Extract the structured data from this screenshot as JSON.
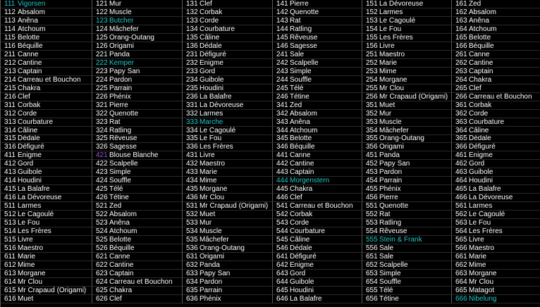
{
  "colors": {
    "background": "#000000",
    "text": "#ffffff",
    "highlight": "#22c7c7",
    "purple": "#9a55d8",
    "gridline": "#5a5a5a"
  },
  "columns": [
    {
      "rows": [
        {
          "n": "111",
          "name": "Vigorsen",
          "hl": "full"
        },
        {
          "n": "112",
          "name": "Absalom"
        },
        {
          "n": "113",
          "name": "Anêna"
        },
        {
          "n": "114",
          "name": "Atchoum"
        },
        {
          "n": "115",
          "name": "Belotte"
        },
        {
          "n": "116",
          "name": "Béquille"
        },
        {
          "n": "211",
          "name": "Canne"
        },
        {
          "n": "212",
          "name": "Cantine"
        },
        {
          "n": "213",
          "name": "Captain"
        },
        {
          "n": "214",
          "name": "Carreau et Bouchon"
        },
        {
          "n": "215",
          "name": "Chakra"
        },
        {
          "n": "216",
          "name": "Clef"
        },
        {
          "n": "311",
          "name": "Corbak"
        },
        {
          "n": "312",
          "name": "Corde"
        },
        {
          "n": "313",
          "name": "Courbature"
        },
        {
          "n": "314",
          "name": "Câline"
        },
        {
          "n": "315",
          "name": "Dédale"
        },
        {
          "n": "316",
          "name": "Défiguré"
        },
        {
          "n": "411",
          "name": "Enigme"
        },
        {
          "n": "412",
          "name": "Gord"
        },
        {
          "n": "413",
          "name": "Guibole"
        },
        {
          "n": "414",
          "name": "Houdini"
        },
        {
          "n": "415",
          "name": "La Balafre"
        },
        {
          "n": "416",
          "name": "La Dévoreuse"
        },
        {
          "n": "511",
          "name": "Larmes"
        },
        {
          "n": "512",
          "name": "Le Cagoulé"
        },
        {
          "n": "513",
          "name": "Le Fou"
        },
        {
          "n": "514",
          "name": "Les Frères"
        },
        {
          "n": "515",
          "name": "Livre"
        },
        {
          "n": "516",
          "name": "Maestro"
        },
        {
          "n": "611",
          "name": "Marie"
        },
        {
          "n": "612",
          "name": "Mime"
        },
        {
          "n": "613",
          "name": "Morgane"
        },
        {
          "n": "614",
          "name": "Mr Clou"
        },
        {
          "n": "615",
          "name": "Mr Crapaud (Origami)"
        },
        {
          "n": "616",
          "name": "Muet"
        }
      ]
    },
    {
      "rows": [
        {
          "n": "121",
          "name": "Mur"
        },
        {
          "n": "122",
          "name": "Muscle"
        },
        {
          "n": "123",
          "name": "Butcher",
          "hl": "full"
        },
        {
          "n": "124",
          "name": "Mâchefer"
        },
        {
          "n": "125",
          "name": "Orang-Outang"
        },
        {
          "n": "126",
          "name": "Origami"
        },
        {
          "n": "221",
          "name": "Panda"
        },
        {
          "n": "222",
          "name": "Kemper",
          "hl": "full"
        },
        {
          "n": "223",
          "name": "Papy San"
        },
        {
          "n": "224",
          "name": "Pardon"
        },
        {
          "n": "225",
          "name": "Parrain"
        },
        {
          "n": "226",
          "name": "Phénix"
        },
        {
          "n": "321",
          "name": "Pierre"
        },
        {
          "n": "322",
          "name": "Quenotte"
        },
        {
          "n": "323",
          "name": "Rat"
        },
        {
          "n": "324",
          "name": "Ratling"
        },
        {
          "n": "325",
          "name": "Rêveuse"
        },
        {
          "n": "326",
          "name": "Sagesse"
        },
        {
          "n": "421",
          "name": "Blouse Blanche",
          "hl": "purplenum"
        },
        {
          "n": "422",
          "name": "Scalpelle"
        },
        {
          "n": "423",
          "name": "Simple"
        },
        {
          "n": "424",
          "name": "Souffle"
        },
        {
          "n": "425",
          "name": "Télé"
        },
        {
          "n": "426",
          "name": "Tétine"
        },
        {
          "n": "521",
          "name": "Zed"
        },
        {
          "n": "522",
          "name": "Absalom"
        },
        {
          "n": "523",
          "name": "Anêna"
        },
        {
          "n": "524",
          "name": "Atchoum"
        },
        {
          "n": "525",
          "name": "Belotte"
        },
        {
          "n": "526",
          "name": "Béquille"
        },
        {
          "n": "621",
          "name": "Canne"
        },
        {
          "n": "622",
          "name": "Cantine"
        },
        {
          "n": "623",
          "name": "Captain"
        },
        {
          "n": "624",
          "name": "Carreau et Bouchon"
        },
        {
          "n": "625",
          "name": "Chakra"
        },
        {
          "n": "626",
          "name": "Clef"
        }
      ]
    },
    {
      "rows": [
        {
          "n": "131",
          "name": "Clef"
        },
        {
          "n": "132",
          "name": "Corbak"
        },
        {
          "n": "133",
          "name": "Corde"
        },
        {
          "n": "134",
          "name": "Courbature"
        },
        {
          "n": "135",
          "name": "Câline"
        },
        {
          "n": "136",
          "name": "Dédale"
        },
        {
          "n": "231",
          "name": "Défiguré"
        },
        {
          "n": "232",
          "name": "Enigme"
        },
        {
          "n": "233",
          "name": "Gord"
        },
        {
          "n": "234",
          "name": "Guibole"
        },
        {
          "n": "235",
          "name": "Houdini"
        },
        {
          "n": "236",
          "name": "La Balafre"
        },
        {
          "n": "331",
          "name": "La Dévoreuse"
        },
        {
          "n": "332",
          "name": "Larmes"
        },
        {
          "n": "333",
          "name": "Marche",
          "hl": "full"
        },
        {
          "n": "334",
          "name": "Le Cagoulé"
        },
        {
          "n": "335",
          "name": "Le Fou"
        },
        {
          "n": "336",
          "name": "Les Frères"
        },
        {
          "n": "431",
          "name": "Livre"
        },
        {
          "n": "432",
          "name": "Maestro"
        },
        {
          "n": "433",
          "name": "Marie"
        },
        {
          "n": "434",
          "name": "Mime"
        },
        {
          "n": "435",
          "name": "Morgane"
        },
        {
          "n": "436",
          "name": "Mr Clou"
        },
        {
          "n": "531",
          "name": "Mr Crapaud (Origami)"
        },
        {
          "n": "532",
          "name": "Muet"
        },
        {
          "n": "533",
          "name": "Mur"
        },
        {
          "n": "534",
          "name": "Muscle"
        },
        {
          "n": "535",
          "name": "Mâchefer"
        },
        {
          "n": "536",
          "name": "Orang-Outang"
        },
        {
          "n": "631",
          "name": "Origami"
        },
        {
          "n": "632",
          "name": "Panda"
        },
        {
          "n": "633",
          "name": "Papy San"
        },
        {
          "n": "634",
          "name": "Pardon"
        },
        {
          "n": "635",
          "name": "Parrain"
        },
        {
          "n": "636",
          "name": "Phénix"
        }
      ]
    },
    {
      "rows": [
        {
          "n": "141",
          "name": "Pierre"
        },
        {
          "n": "142",
          "name": "Quenotte"
        },
        {
          "n": "143",
          "name": "Rat"
        },
        {
          "n": "144",
          "name": "Ratling"
        },
        {
          "n": "145",
          "name": "Rêveuse"
        },
        {
          "n": "146",
          "name": "Sagesse"
        },
        {
          "n": "241",
          "name": "Sale"
        },
        {
          "n": "242",
          "name": "Scalpelle"
        },
        {
          "n": "243",
          "name": "Simple"
        },
        {
          "n": "244",
          "name": "Souffle"
        },
        {
          "n": "245",
          "name": "Télé"
        },
        {
          "n": "246",
          "name": "Tétine"
        },
        {
          "n": "341",
          "name": "Zed"
        },
        {
          "n": "342",
          "name": "Absalom"
        },
        {
          "n": "343",
          "name": "Anêna"
        },
        {
          "n": "344",
          "name": "Atchoum"
        },
        {
          "n": "345",
          "name": "Belotte"
        },
        {
          "n": "346",
          "name": "Béquille"
        },
        {
          "n": "441",
          "name": "Canne"
        },
        {
          "n": "442",
          "name": "Cantine"
        },
        {
          "n": "443",
          "name": "Captain"
        },
        {
          "n": "444",
          "name": "Morgenstern",
          "hl": "full"
        },
        {
          "n": "445",
          "name": "Chakra"
        },
        {
          "n": "446",
          "name": "Clef"
        },
        {
          "n": "541",
          "name": "Carreau et Bouchon"
        },
        {
          "n": "542",
          "name": "Corbak"
        },
        {
          "n": "543",
          "name": "Corde"
        },
        {
          "n": "544",
          "name": "Courbature"
        },
        {
          "n": "545",
          "name": "Câline"
        },
        {
          "n": "546",
          "name": "Dédale"
        },
        {
          "n": "641",
          "name": "Défiguré"
        },
        {
          "n": "642",
          "name": "Enigme"
        },
        {
          "n": "643",
          "name": "Gord"
        },
        {
          "n": "644",
          "name": "Guibole"
        },
        {
          "n": "645",
          "name": "Houdini"
        },
        {
          "n": "646",
          "name": "La Balafre"
        }
      ]
    },
    {
      "rows": [
        {
          "n": "151",
          "name": "La Dévoreuse"
        },
        {
          "n": "152",
          "name": "Larmes"
        },
        {
          "n": "153",
          "name": "Le Cagoulé"
        },
        {
          "n": "154",
          "name": "Le Fou"
        },
        {
          "n": "155",
          "name": "Les Frères"
        },
        {
          "n": "156",
          "name": "Livre"
        },
        {
          "n": "251",
          "name": "Maestro"
        },
        {
          "n": "252",
          "name": "Marie"
        },
        {
          "n": "253",
          "name": "Mime"
        },
        {
          "n": "254",
          "name": "Morgane"
        },
        {
          "n": "255",
          "name": "Mr Clou"
        },
        {
          "n": "256",
          "name": "Mr Crapaud (Origami)"
        },
        {
          "n": "351",
          "name": "Muet"
        },
        {
          "n": "352",
          "name": "Mur"
        },
        {
          "n": "353",
          "name": "Muscle"
        },
        {
          "n": "354",
          "name": "Mâchefer"
        },
        {
          "n": "355",
          "name": "Orang-Outang"
        },
        {
          "n": "356",
          "name": "Origami"
        },
        {
          "n": "451",
          "name": "Panda"
        },
        {
          "n": "452",
          "name": "Papy San"
        },
        {
          "n": "453",
          "name": "Pardon"
        },
        {
          "n": "454",
          "name": "Parrain"
        },
        {
          "n": "455",
          "name": "Phénix"
        },
        {
          "n": "456",
          "name": "Pierre"
        },
        {
          "n": "551",
          "name": "Quenotte"
        },
        {
          "n": "552",
          "name": "Rat"
        },
        {
          "n": "553",
          "name": "Ratling"
        },
        {
          "n": "554",
          "name": "Rêveuse"
        },
        {
          "n": "555",
          "name": "Stein & Frank",
          "hl": "full"
        },
        {
          "n": "556",
          "name": "Sale"
        },
        {
          "n": "651",
          "name": "Sale"
        },
        {
          "n": "652",
          "name": "Scalpelle"
        },
        {
          "n": "653",
          "name": "Simple"
        },
        {
          "n": "654",
          "name": "Souffle"
        },
        {
          "n": "655",
          "name": "Télé"
        },
        {
          "n": "656",
          "name": "Tétine"
        }
      ]
    },
    {
      "rows": [
        {
          "n": "161",
          "name": "Zed"
        },
        {
          "n": "162",
          "name": "Absalom"
        },
        {
          "n": "163",
          "name": "Anêna"
        },
        {
          "n": "164",
          "name": "Atchoum"
        },
        {
          "n": "165",
          "name": "Belotte"
        },
        {
          "n": "166",
          "name": "Béquille"
        },
        {
          "n": "261",
          "name": "Canne"
        },
        {
          "n": "262",
          "name": "Cantine"
        },
        {
          "n": "263",
          "name": "Captain"
        },
        {
          "n": "264",
          "name": "Chakra"
        },
        {
          "n": "265",
          "name": "Clef"
        },
        {
          "n": "266",
          "name": "Carreau et Bouchon"
        },
        {
          "n": "361",
          "name": "Corbak"
        },
        {
          "n": "362",
          "name": "Corde"
        },
        {
          "n": "363",
          "name": "Courbature"
        },
        {
          "n": "364",
          "name": "Câline"
        },
        {
          "n": "365",
          "name": "Dédale"
        },
        {
          "n": "366",
          "name": "Défiguré"
        },
        {
          "n": "461",
          "name": "Enigme"
        },
        {
          "n": "462",
          "name": "Gord"
        },
        {
          "n": "463",
          "name": "Guibole"
        },
        {
          "n": "464",
          "name": "Houdini"
        },
        {
          "n": "465",
          "name": "La Balafre"
        },
        {
          "n": "466",
          "name": "La Dévoreuse"
        },
        {
          "n": "561",
          "name": "Larmes"
        },
        {
          "n": "562",
          "name": "Le Cagoulé"
        },
        {
          "n": "563",
          "name": "Le Fou"
        },
        {
          "n": "564",
          "name": "Les Frères"
        },
        {
          "n": "565",
          "name": "Livre"
        },
        {
          "n": "566",
          "name": "Maestro"
        },
        {
          "n": "661",
          "name": "Marie"
        },
        {
          "n": "662",
          "name": "Mime"
        },
        {
          "n": "663",
          "name": "Morgane"
        },
        {
          "n": "664",
          "name": "Mr Clou"
        },
        {
          "n": "665",
          "name": "Matagot"
        },
        {
          "n": "666",
          "name": "Nibelung",
          "hl": "full"
        }
      ]
    }
  ]
}
